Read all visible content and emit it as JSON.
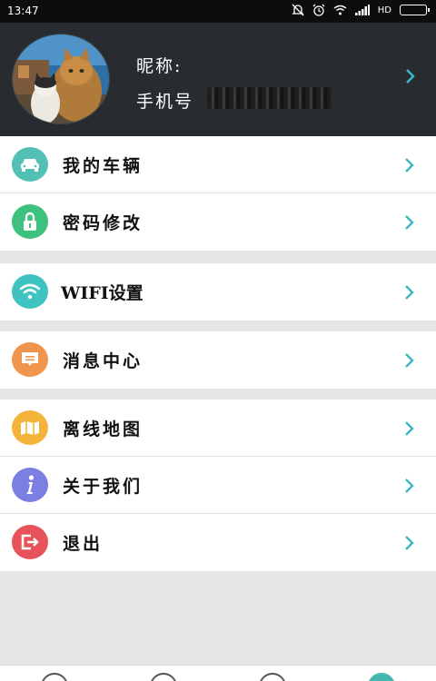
{
  "status_bar": {
    "time": "13:47",
    "network": "HD"
  },
  "profile": {
    "nickname_label": "昵称:",
    "phone_label": "手机号"
  },
  "menu": {
    "my_vehicle": "我的车辆",
    "change_password": "密码修改",
    "wifi_settings": "WIFI设置",
    "message_center": "消息中心",
    "offline_map": "离线地图",
    "about_us": "关于我们",
    "logout": "退出"
  },
  "icon_colors": {
    "my_vehicle": "#52c0b4",
    "change_password": "#3cc27c",
    "wifi_settings": "#3ec3c0",
    "message_center": "#f0954d",
    "offline_map": "#f4b33b",
    "about_us": "#7b7fe2",
    "logout": "#e8535b"
  },
  "icons": {
    "my_vehicle": "car-icon",
    "change_password": "lock-icon",
    "wifi_settings": "wifi-icon",
    "message_center": "message-icon",
    "offline_map": "map-icon",
    "about_us": "info-icon",
    "logout": "logout-icon"
  },
  "accent_color": "#42b8b0"
}
